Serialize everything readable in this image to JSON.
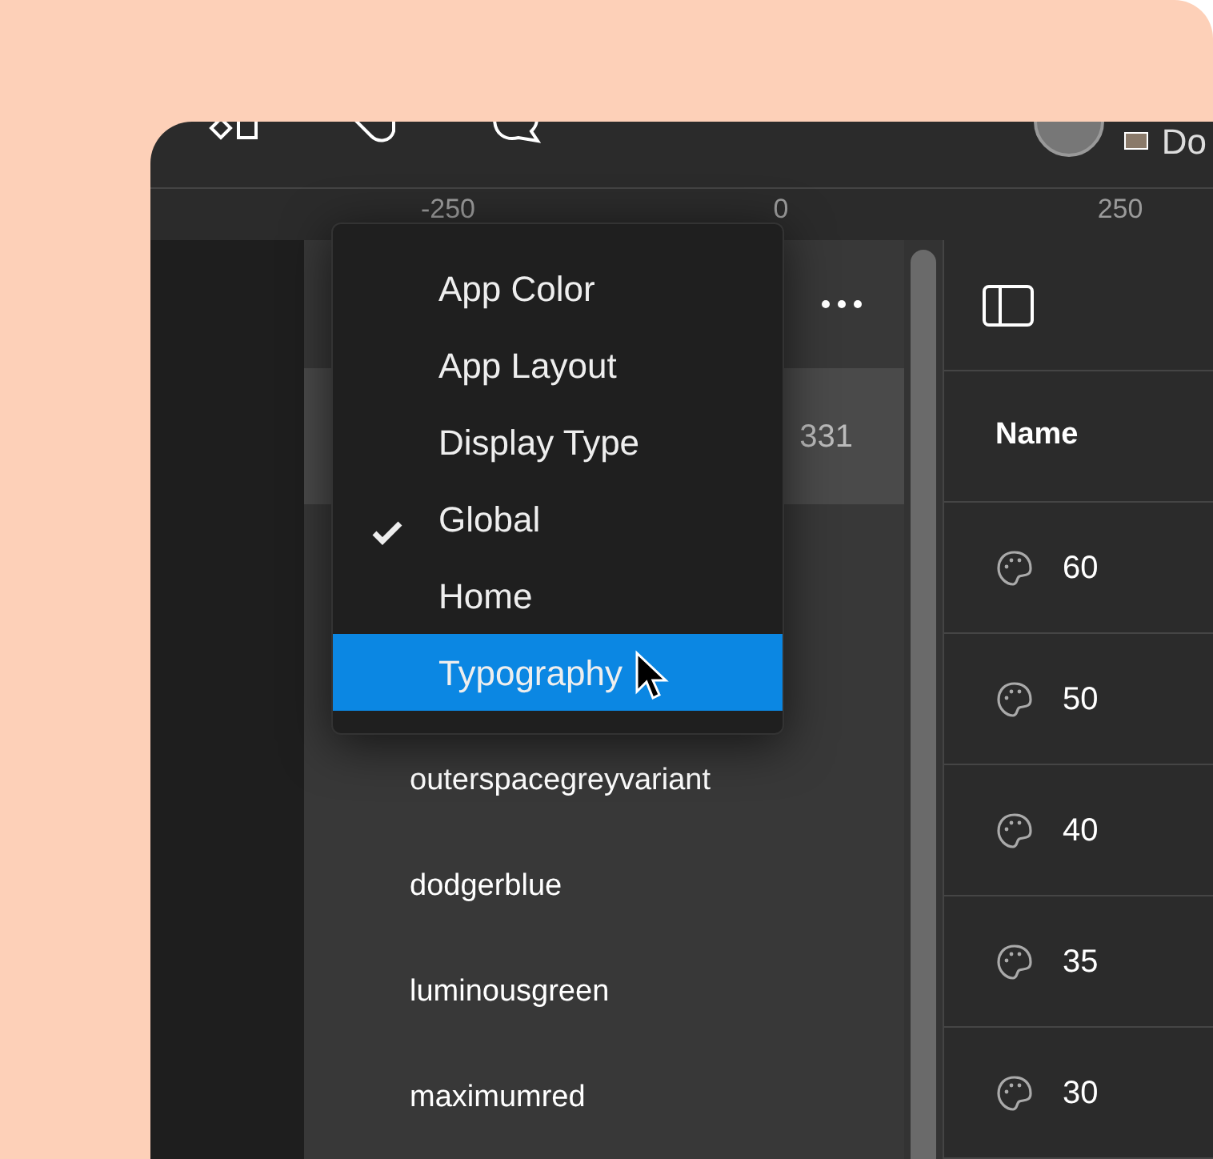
{
  "toolbar": {
    "user_label": "Do"
  },
  "ruler": {
    "ticks": [
      "-250",
      "0",
      "250"
    ]
  },
  "layer_panel": {
    "rows": [
      {
        "trailing": "331",
        "selected": true
      },
      {
        "name": "outerspacegreyvariant",
        "selected": false
      },
      {
        "name": "dodgerblue",
        "selected": false
      },
      {
        "name": "luminousgreen",
        "selected": false
      },
      {
        "name": "maximumred",
        "selected": false
      }
    ]
  },
  "dropdown_menu": {
    "items": [
      {
        "label": "App Color",
        "checked": false,
        "selected": false
      },
      {
        "label": "App Layout",
        "checked": false,
        "selected": false
      },
      {
        "label": "Display Type",
        "checked": false,
        "selected": false
      },
      {
        "label": "Global",
        "checked": true,
        "selected": false
      },
      {
        "label": "Home",
        "checked": false,
        "selected": false
      },
      {
        "label": "Typography",
        "checked": false,
        "selected": true
      }
    ]
  },
  "table": {
    "columns": [
      "Name"
    ],
    "rows": [
      {
        "name": "60"
      },
      {
        "name": "50"
      },
      {
        "name": "40"
      },
      {
        "name": "35"
      },
      {
        "name": "30"
      }
    ]
  }
}
